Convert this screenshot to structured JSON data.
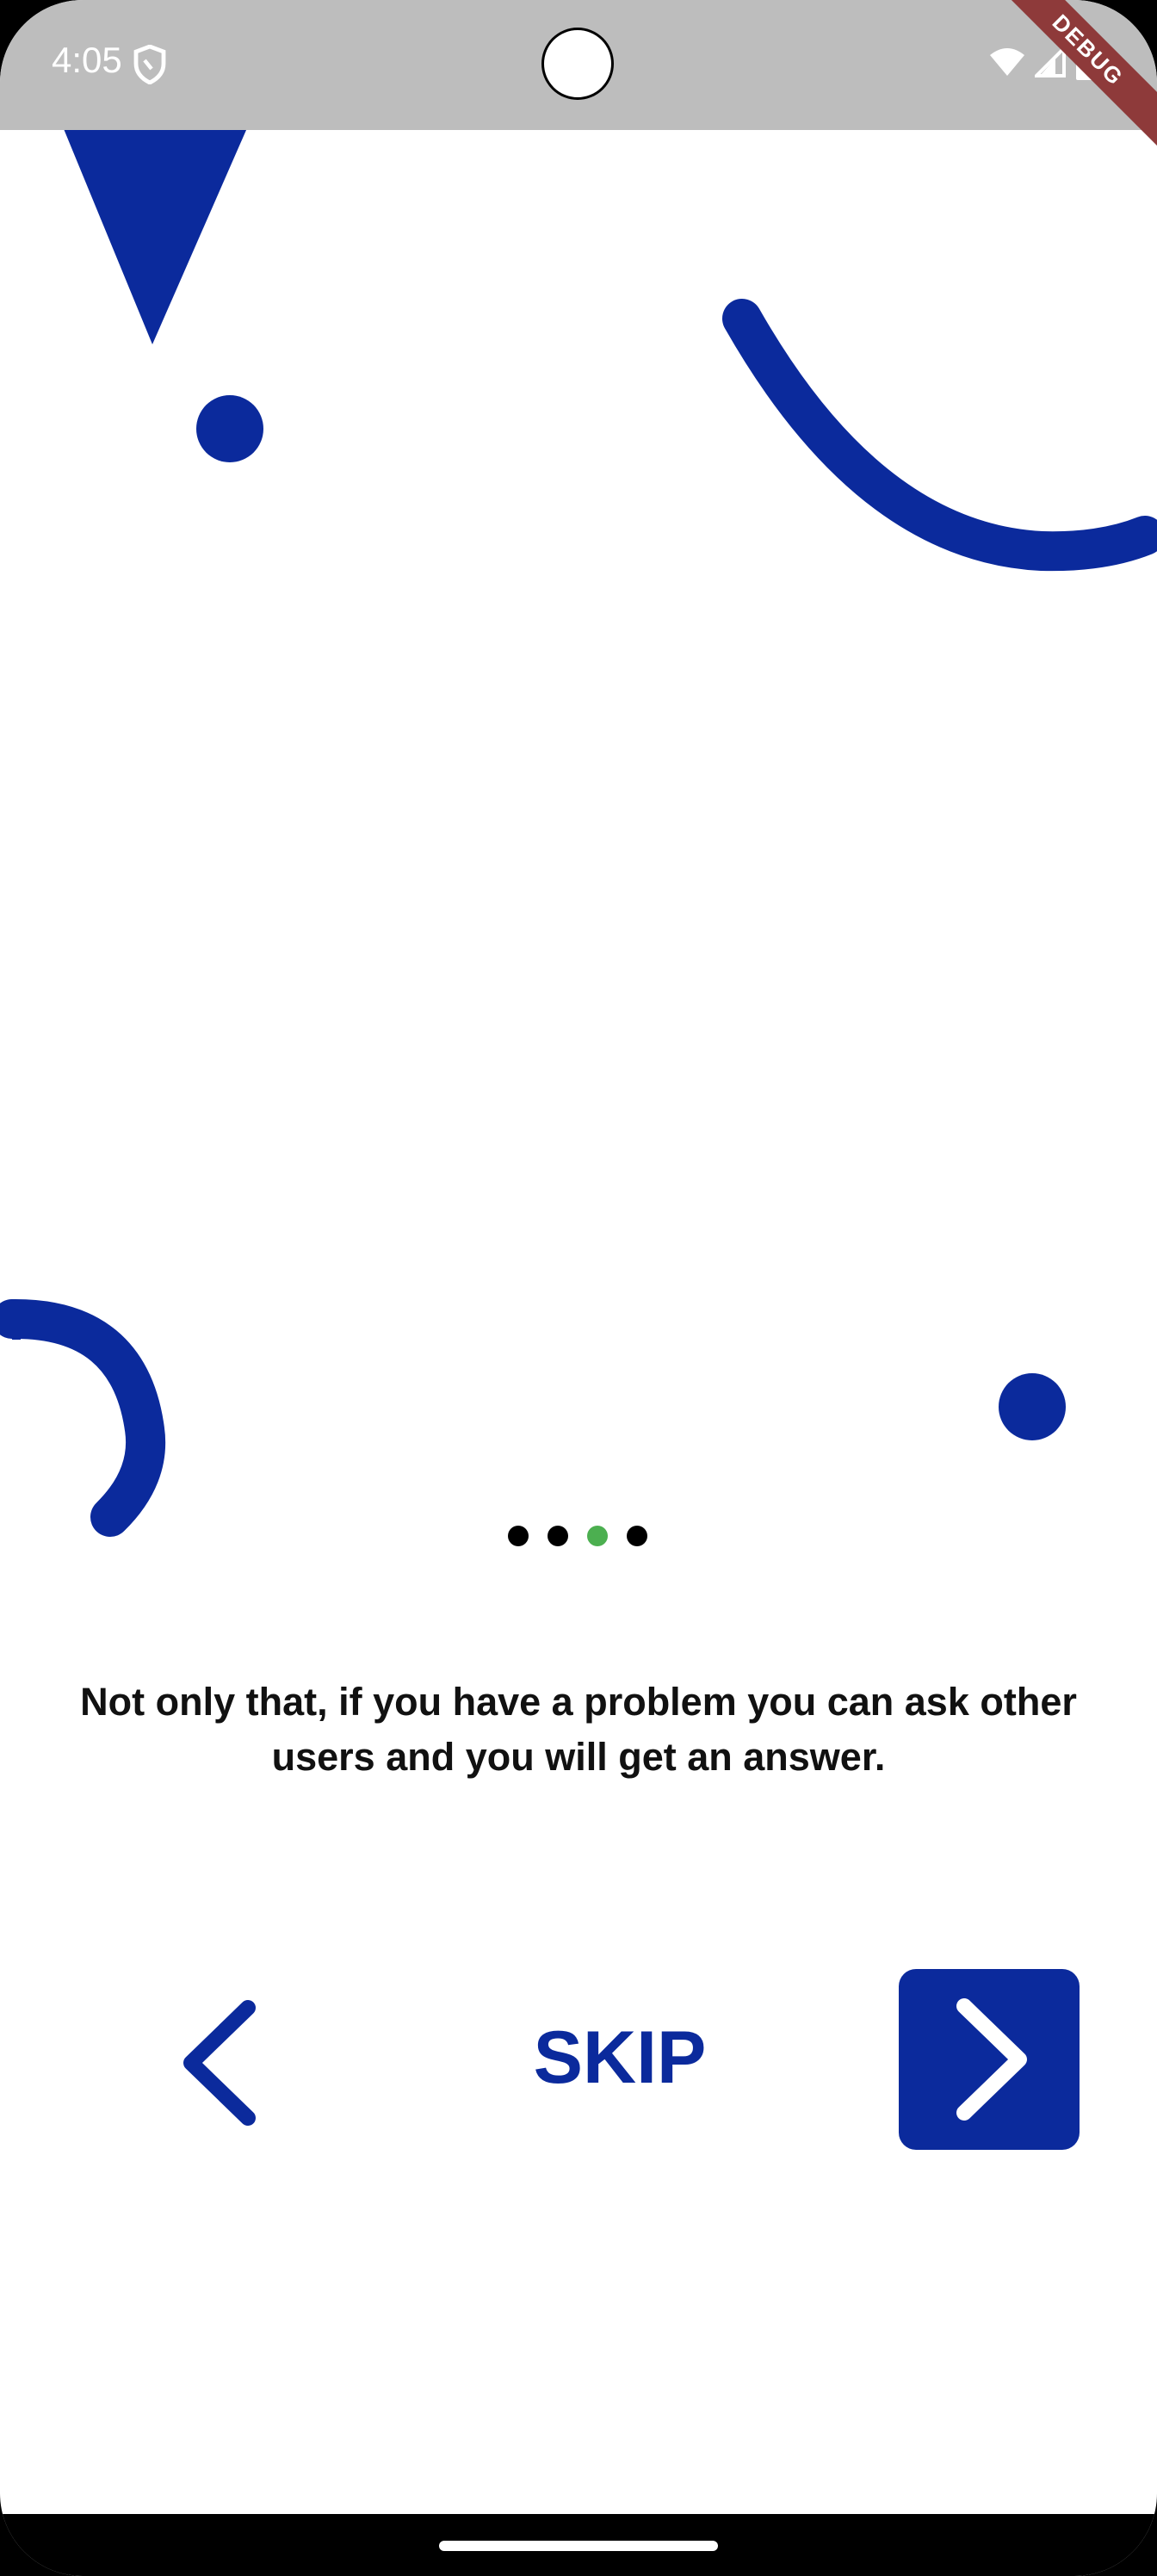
{
  "status_bar": {
    "time": "4:05"
  },
  "debug_banner": {
    "label": "DEBUG"
  },
  "onboarding": {
    "page_indicator": {
      "total": 4,
      "current": 3
    },
    "message": "Not only that, if you have a problem you can ask other users and you will get an answer.",
    "skip_label": "SKIP"
  },
  "colors": {
    "accent": "#0B2A9C",
    "active_dot": "#4CAF50",
    "inactive_dot": "#000000",
    "status_bar": "#BDBDBD"
  },
  "icons": {
    "prev": "chevron-left-icon",
    "next": "chevron-right-icon",
    "status": [
      "shield-icon",
      "wifi-icon",
      "signal-icon",
      "battery-icon"
    ]
  }
}
